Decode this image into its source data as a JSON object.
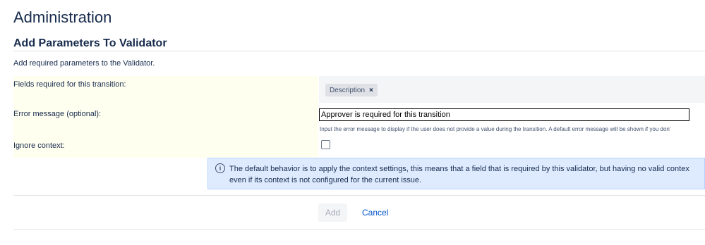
{
  "page": {
    "title": "Administration"
  },
  "section": {
    "title": "Add Parameters To Validator",
    "description": "Add required parameters to the Validator."
  },
  "form": {
    "fields_label": "Fields required for this transition:",
    "selected_field": "Description",
    "remove_icon": "×",
    "error_label": "Error message (optional):",
    "error_value": "Approver is required for this transition",
    "error_help": "Input the error message to display if the user does not provide a value during the transition. A default error message will be shown if you don'",
    "ignore_label": "Ignore context:",
    "ignore_checked": false
  },
  "info": {
    "icon": "info-icon",
    "line1": "The default behavior is to apply the context settings, this means that a field that is required by this validator, but having no valid contex",
    "line2": "even if its context is not configured for the current issue."
  },
  "actions": {
    "add_label": "Add",
    "cancel_label": "Cancel"
  },
  "colors": {
    "label_bg": "#fffff0",
    "info_bg": "#deebff",
    "link": "#0052cc"
  }
}
